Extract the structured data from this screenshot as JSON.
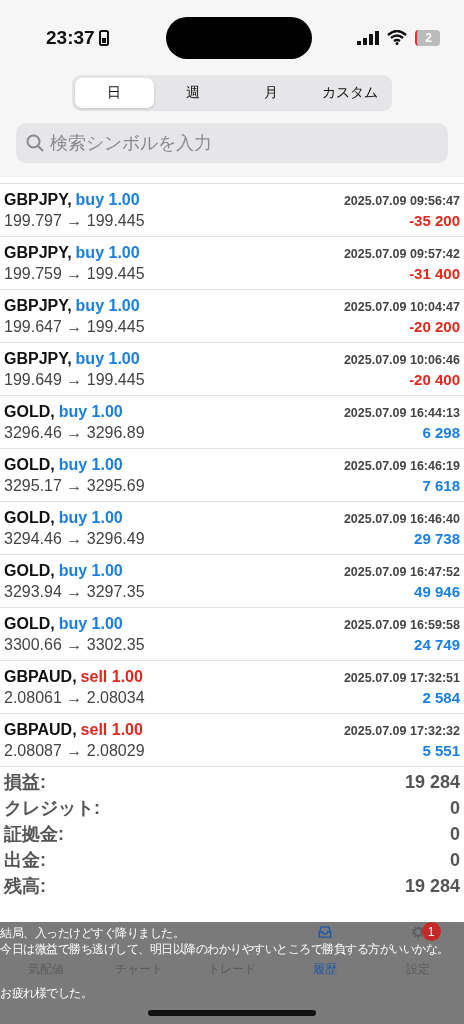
{
  "status_bar": {
    "time": "23:37",
    "battery": "2"
  },
  "period_tabs": [
    {
      "label": "日",
      "selected": true
    },
    {
      "label": "週",
      "selected": false
    },
    {
      "label": "月",
      "selected": false
    },
    {
      "label": "カスタム",
      "selected": false
    }
  ],
  "search": {
    "placeholder": "検索シンボルを入力"
  },
  "deals": [
    {
      "symbol": "GBPJPY,",
      "kind": "buy",
      "type": "buy 1.00",
      "time": "2025.07.09 09:56:47",
      "prices": "199.797 → 199.445",
      "profit": "-35 200",
      "loss": true
    },
    {
      "symbol": "GBPJPY,",
      "kind": "buy",
      "type": "buy 1.00",
      "time": "2025.07.09 09:57:42",
      "prices": "199.759 → 199.445",
      "profit": "-31 400",
      "loss": true
    },
    {
      "symbol": "GBPJPY,",
      "kind": "buy",
      "type": "buy 1.00",
      "time": "2025.07.09 10:04:47",
      "prices": "199.647 → 199.445",
      "profit": "-20 200",
      "loss": true
    },
    {
      "symbol": "GBPJPY,",
      "kind": "buy",
      "type": "buy 1.00",
      "time": "2025.07.09 10:06:46",
      "prices": "199.649 → 199.445",
      "profit": "-20 400",
      "loss": true
    },
    {
      "symbol": "GOLD,",
      "kind": "buy",
      "type": "buy 1.00",
      "time": "2025.07.09 16:44:13",
      "prices": "3296.46 → 3296.89",
      "profit": "6 298",
      "loss": false
    },
    {
      "symbol": "GOLD,",
      "kind": "buy",
      "type": "buy 1.00",
      "time": "2025.07.09 16:46:19",
      "prices": "3295.17 → 3295.69",
      "profit": "7 618",
      "loss": false
    },
    {
      "symbol": "GOLD,",
      "kind": "buy",
      "type": "buy 1.00",
      "time": "2025.07.09 16:46:40",
      "prices": "3294.46 → 3296.49",
      "profit": "29 738",
      "loss": false
    },
    {
      "symbol": "GOLD,",
      "kind": "buy",
      "type": "buy 1.00",
      "time": "2025.07.09 16:47:52",
      "prices": "3293.94 → 3297.35",
      "profit": "49 946",
      "loss": false
    },
    {
      "symbol": "GOLD,",
      "kind": "buy",
      "type": "buy 1.00",
      "time": "2025.07.09 16:59:58",
      "prices": "3300.66 → 3302.35",
      "profit": "24 749",
      "loss": false
    },
    {
      "symbol": "GBPAUD,",
      "kind": "sell",
      "type": "sell 1.00",
      "time": "2025.07.09 17:32:51",
      "prices": "2.08061 → 2.08034",
      "profit": "2 584",
      "loss": false
    },
    {
      "symbol": "GBPAUD,",
      "kind": "sell",
      "type": "sell 1.00",
      "time": "2025.07.09 17:32:32",
      "prices": "2.08087 → 2.08029",
      "profit": "5 551",
      "loss": false
    }
  ],
  "summary": [
    {
      "label": "損益:",
      "value": "19 284"
    },
    {
      "label": "クレジット:",
      "value": "0"
    },
    {
      "label": "証拠金:",
      "value": "0"
    },
    {
      "label": "出金:",
      "value": "0"
    },
    {
      "label": "残高:",
      "value": "19 284"
    }
  ],
  "tab_bar": [
    {
      "label": "気配値",
      "selected": false
    },
    {
      "label": "チャート",
      "selected": false
    },
    {
      "label": "トレード",
      "selected": false
    },
    {
      "kind": "history",
      "label": "履歴",
      "selected": true
    },
    {
      "kind": "settings",
      "label": "設定",
      "selected": false,
      "badge": "1"
    }
  ],
  "caption": [
    "結局、入ったけどすぐ降りました。",
    "今日は微益で勝ち逃げして、明日以降のわかりやすいところで勝負する方がいいかな。",
    "お疲れ様でした。"
  ]
}
